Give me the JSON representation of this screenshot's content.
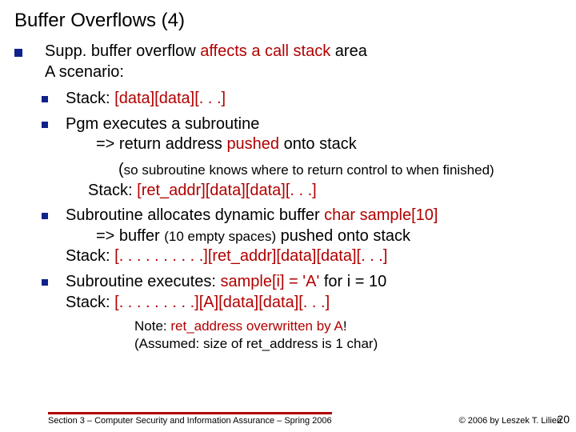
{
  "title": "Buffer Overflows (4)",
  "intro": {
    "part_a": "Supp. buffer overflow ",
    "affects": "affects a call stack",
    "part_b": " area",
    "line2": "A scenario:"
  },
  "b1": {
    "pre": "Stack: ",
    "red": "[data][data][. . .]"
  },
  "b2": {
    "l1": "Pgm executes a subroutine",
    "l2_pre": "=> return address ",
    "l2_red": "pushed",
    "l2_post": " onto stack",
    "paren_open": "(",
    "paren_txt": "so subroutine knows where to return control to when finished)",
    "stack_pre": "Stack: ",
    "stack_red": "[ret_addr][data][data][. . .]"
  },
  "b3": {
    "l1_a": "Subroutine allocates dynamic buffer ",
    "l1_red": "char sample[10]",
    "l2_a": "=> buffer ",
    "l2_paren": "(10 empty spaces)",
    "l2_b": " pushed onto stack",
    "stack_pre": "Stack: ",
    "stack_red": "[. . . . . . . . . .][ret_addr][data][data][. . .]"
  },
  "b4": {
    "l1_a": "Subroutine executes: ",
    "l1_red": "sample[i] = 'A'",
    "l1_b": " for i = 10",
    "stack_pre": "Stack: ",
    "stack_red": "[. . . . . . . . .][A][data][data][. . .]"
  },
  "note": {
    "l1_a": "Note: ",
    "l1_red": "ret_address overwritten by A",
    "l1_b": "!",
    "l2": "(Assumed: size of ret_address is 1 char)"
  },
  "footer": {
    "left": "Section 3 – Computer Security and Information Assurance – Spring 2006",
    "right": "© 2006 by Leszek T. Lilien"
  },
  "page": "20"
}
